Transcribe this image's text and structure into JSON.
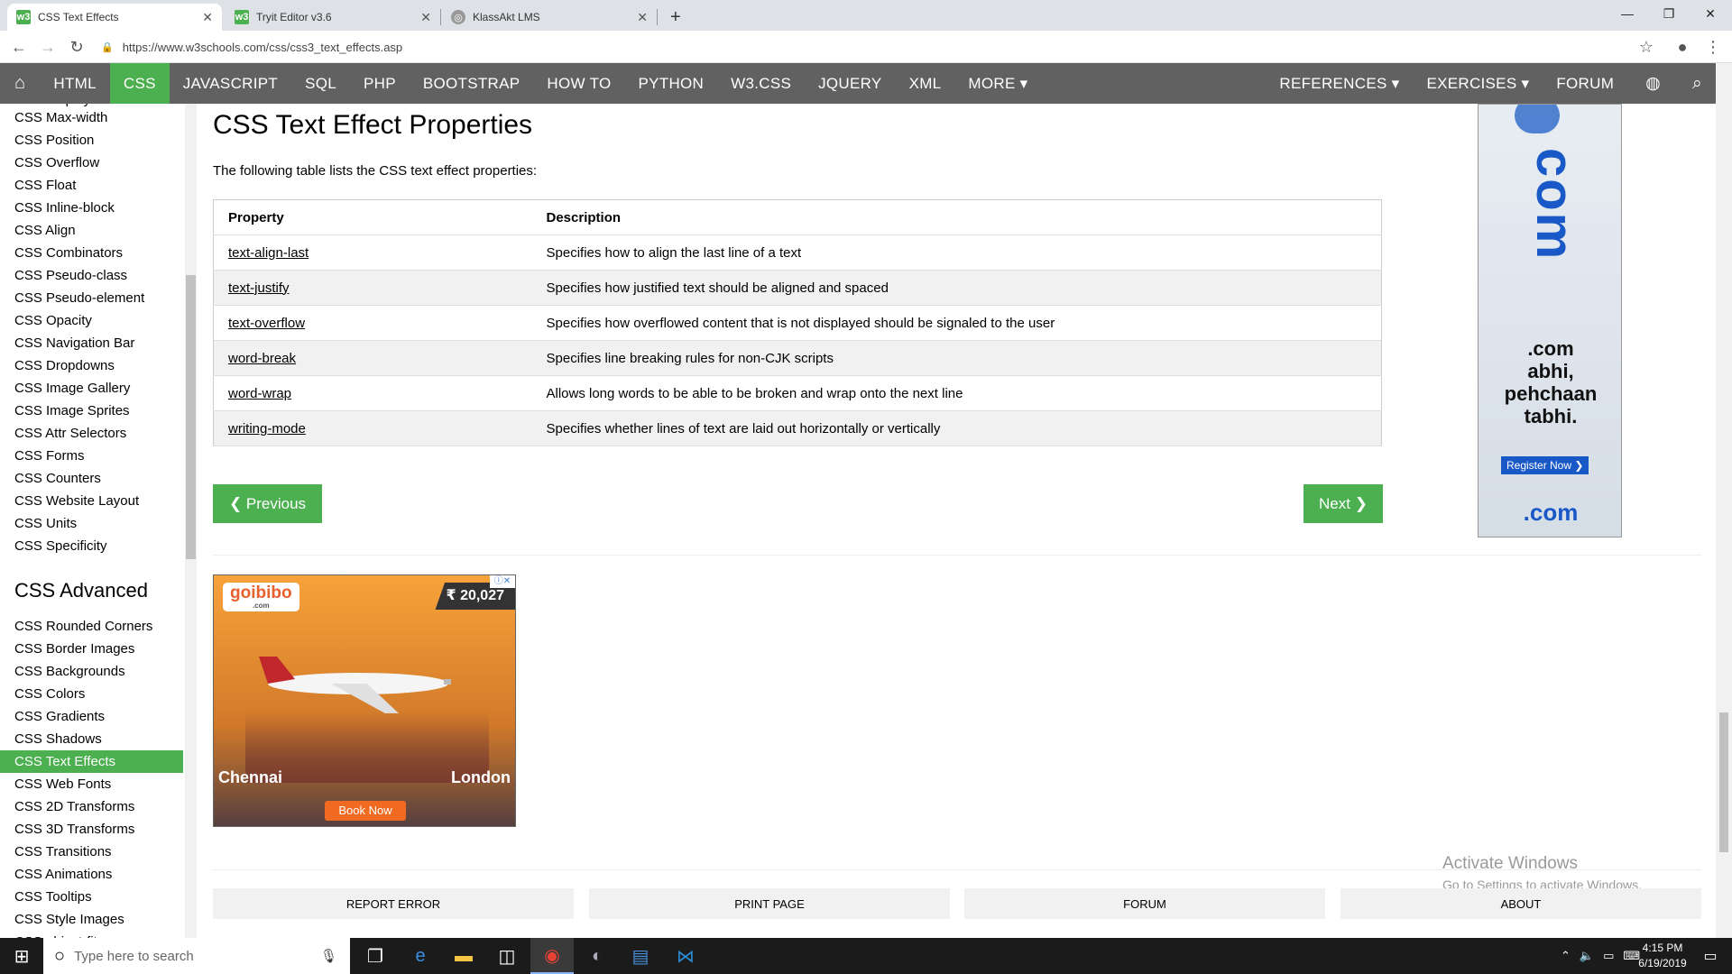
{
  "browser": {
    "tabs": [
      {
        "title": "CSS Text Effects",
        "active": true
      },
      {
        "title": "Tryit Editor v3.6",
        "active": false
      },
      {
        "title": "KlassAkt LMS",
        "active": false
      }
    ],
    "new_tab": "+",
    "url": "https://www.w3schools.com/css/css3_text_effects.asp"
  },
  "topnav": {
    "items": [
      "HTML",
      "CSS",
      "JAVASCRIPT",
      "SQL",
      "PHP",
      "BOOTSTRAP",
      "HOW TO",
      "PYTHON",
      "W3.CSS",
      "JQUERY",
      "XML",
      "MORE ▾"
    ],
    "active": "CSS",
    "right_items": [
      "REFERENCES ▾",
      "EXERCISES ▾",
      "FORUM"
    ]
  },
  "sidebar": {
    "items_top": [
      "CSS Max-width",
      "CSS Position",
      "CSS Overflow",
      "CSS Float",
      "CSS Inline-block",
      "CSS Align",
      "CSS Combinators",
      "CSS Pseudo-class",
      "CSS Pseudo-element",
      "CSS Opacity",
      "CSS Navigation Bar",
      "CSS Dropdowns",
      "CSS Image Gallery",
      "CSS Image Sprites",
      "CSS Attr Selectors",
      "CSS Forms",
      "CSS Counters",
      "CSS Website Layout",
      "CSS Units",
      "CSS Specificity"
    ],
    "advanced_heading": "CSS Advanced",
    "items_advanced": [
      "CSS Rounded Corners",
      "CSS Border Images",
      "CSS Backgrounds",
      "CSS Colors",
      "CSS Gradients",
      "CSS Shadows",
      "CSS Text Effects",
      "CSS Web Fonts",
      "CSS 2D Transforms",
      "CSS 3D Transforms",
      "CSS Transitions",
      "CSS Animations",
      "CSS Tooltips",
      "CSS Style Images",
      "CSS object-fit"
    ],
    "active": "CSS Text Effects"
  },
  "main": {
    "title": "CSS Text Effect Properties",
    "intro": "The following table lists the CSS text effect properties:",
    "table": {
      "headers": [
        "Property",
        "Description"
      ],
      "rows": [
        [
          "text-align-last",
          "Specifies how to align the last line of a text"
        ],
        [
          "text-justify",
          "Specifies how justified text should be aligned and spaced"
        ],
        [
          "text-overflow",
          "Specifies how overflowed content that is not displayed should be signaled to the user"
        ],
        [
          "word-break",
          "Specifies line breaking rules for non-CJK scripts"
        ],
        [
          "word-wrap",
          "Allows long words to be able to be broken and wrap onto the next line"
        ],
        [
          "writing-mode",
          "Specifies whether lines of text are laid out horizontally or vertically"
        ]
      ]
    },
    "prev_label": "❮ Previous",
    "next_label": "Next ❯"
  },
  "ads": {
    "right": {
      "big_text": "com",
      "line1": ".com",
      "line2": "abhi,",
      "line3": "pehchaan",
      "line4": "tabhi.",
      "cta": "Register Now",
      "logo": ".com"
    },
    "bottom": {
      "brand": "goibibo",
      "brand_sub": ".com",
      "price": "₹ 20,027",
      "from": "Chennai",
      "to": "London",
      "cta": "Book Now"
    }
  },
  "footer_buttons": [
    "REPORT ERROR",
    "PRINT PAGE",
    "FORUM",
    "ABOUT"
  ],
  "watermark": {
    "title": "Activate Windows",
    "sub": "Go to Settings to activate Windows."
  },
  "taskbar": {
    "search_placeholder": "Type here to search",
    "time": "4:15 PM",
    "date": "6/19/2019"
  },
  "colors": {
    "accent": "#4caf50",
    "nav": "#616161",
    "taskbar": "#1b1b1b"
  }
}
